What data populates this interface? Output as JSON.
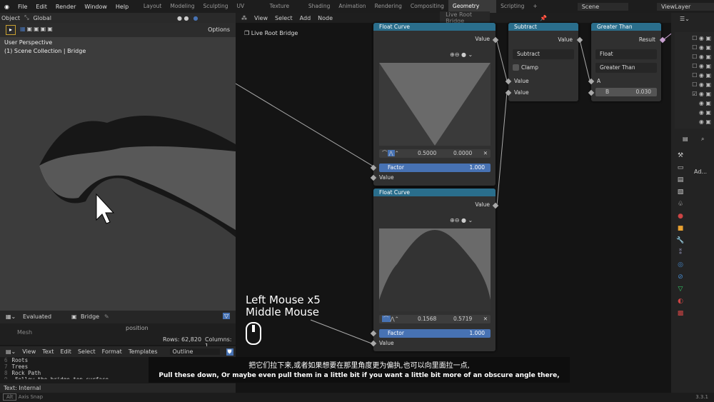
{
  "topbar": {
    "menus": [
      "File",
      "Edit",
      "Render",
      "Window",
      "Help"
    ],
    "workspaces": [
      "Layout",
      "Modeling",
      "Sculpting",
      "UV Editing",
      "Texture Paint",
      "Shading",
      "Animation",
      "Rendering",
      "Compositing",
      "Geometry Nodes",
      "Scripting"
    ],
    "active_workspace": "Geometry Nodes",
    "add_tab": "+",
    "scene": "Scene",
    "view_layer": "ViewLayer"
  },
  "viewport": {
    "mode": "Object",
    "orientation": "Global",
    "options": "Options",
    "overlay_title": "User Perspective",
    "overlay_sub": "(1) Scene Collection | Bridge"
  },
  "node_editor": {
    "menus": [
      "View",
      "Select",
      "Add",
      "Node"
    ],
    "tree_name": "Live Root Bridge",
    "breadcrumb": "Live Root Bridge",
    "nodes": {
      "float_curve_1": {
        "title": "Float Curve",
        "output": "Value",
        "x": "0.5000",
        "y": "0.0000",
        "factor_label": "Factor",
        "factor_value": "1.000",
        "input": "Value"
      },
      "float_curve_2": {
        "title": "Float Curve",
        "output": "Value",
        "x": "0.1568",
        "y": "0.5719",
        "factor_label": "Factor",
        "factor_value": "1.000",
        "input": "Value"
      },
      "subtract": {
        "title": "Subtract",
        "output": "Value",
        "operation": "Subtract",
        "clamp": "Clamp",
        "in1": "Value",
        "in2": "Value"
      },
      "greater": {
        "title": "Greater Than",
        "output": "Result",
        "type": "Float",
        "operation": "Greater Than",
        "a": "A",
        "b_label": "B",
        "b_value": "0.030"
      }
    }
  },
  "overlay_keys": {
    "line1": "Left Mouse x5",
    "line2": "Middle Mouse"
  },
  "spreadsheet": {
    "mode": "Evaluated",
    "object": "Bridge",
    "domain": "Mesh",
    "column": "position",
    "rows": "Rows: 62,820",
    "columns": "Columns: 1"
  },
  "text_editor": {
    "menus": [
      "View",
      "Text",
      "Edit",
      "Select",
      "Format",
      "Templates"
    ],
    "file": "Outline",
    "lines": [
      {
        "n": "6",
        "t": "Roots"
      },
      {
        "n": "7",
        "t": "Trees"
      },
      {
        "n": "8",
        "t": "Rock Path"
      },
      {
        "n": "9",
        "t": "    Follow the bridge top surface"
      }
    ],
    "footer": "Text: Internal"
  },
  "properties": {
    "add_label": "Ad..."
  },
  "subtitle": {
    "zh": "把它们拉下来,或者如果想要在那里角度更为偏执,也可以向里面拉一点,",
    "en": "Pull these down, Or maybe even pull them in a little bit if you want a little bit more of an obscure angle there,"
  },
  "status": {
    "left": "Axis Snap",
    "version": "3.3.1"
  }
}
